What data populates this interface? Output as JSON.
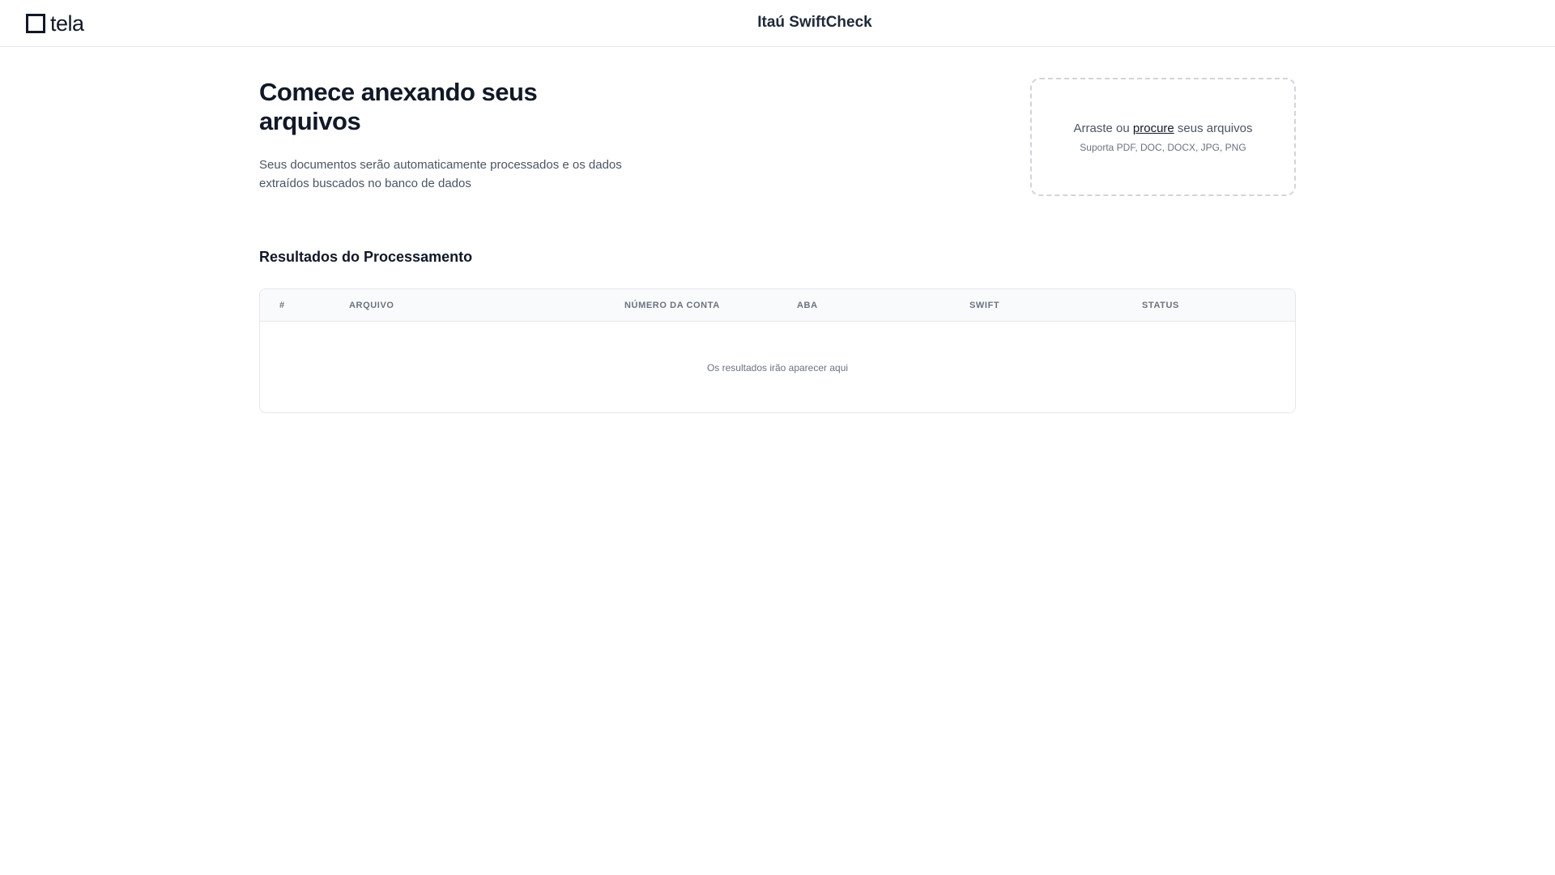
{
  "header": {
    "logo_text": "tela",
    "app_title": "Itaú SwiftCheck"
  },
  "intro": {
    "heading": "Comece anexando seus arquivos",
    "description": "Seus documentos serão automaticamente processados e os dados extraídos buscados no banco de dados"
  },
  "dropzone": {
    "text_before": "Arraste ou ",
    "link_label": "procure",
    "text_after": " seus arquivos",
    "supported": "Suporta PDF, DOC, DOCX, JPG, PNG"
  },
  "results": {
    "title": "Resultados do Processamento",
    "columns": [
      "#",
      "Arquivo",
      "Número da Conta",
      "ABA",
      "Swift",
      "Status"
    ],
    "empty_message": "Os resultados irão aparecer aqui"
  },
  "colors": {
    "text_primary": "#111827",
    "text_muted": "#6b7280",
    "border": "#e5e7eb",
    "header_bg": "#f9fafb"
  }
}
